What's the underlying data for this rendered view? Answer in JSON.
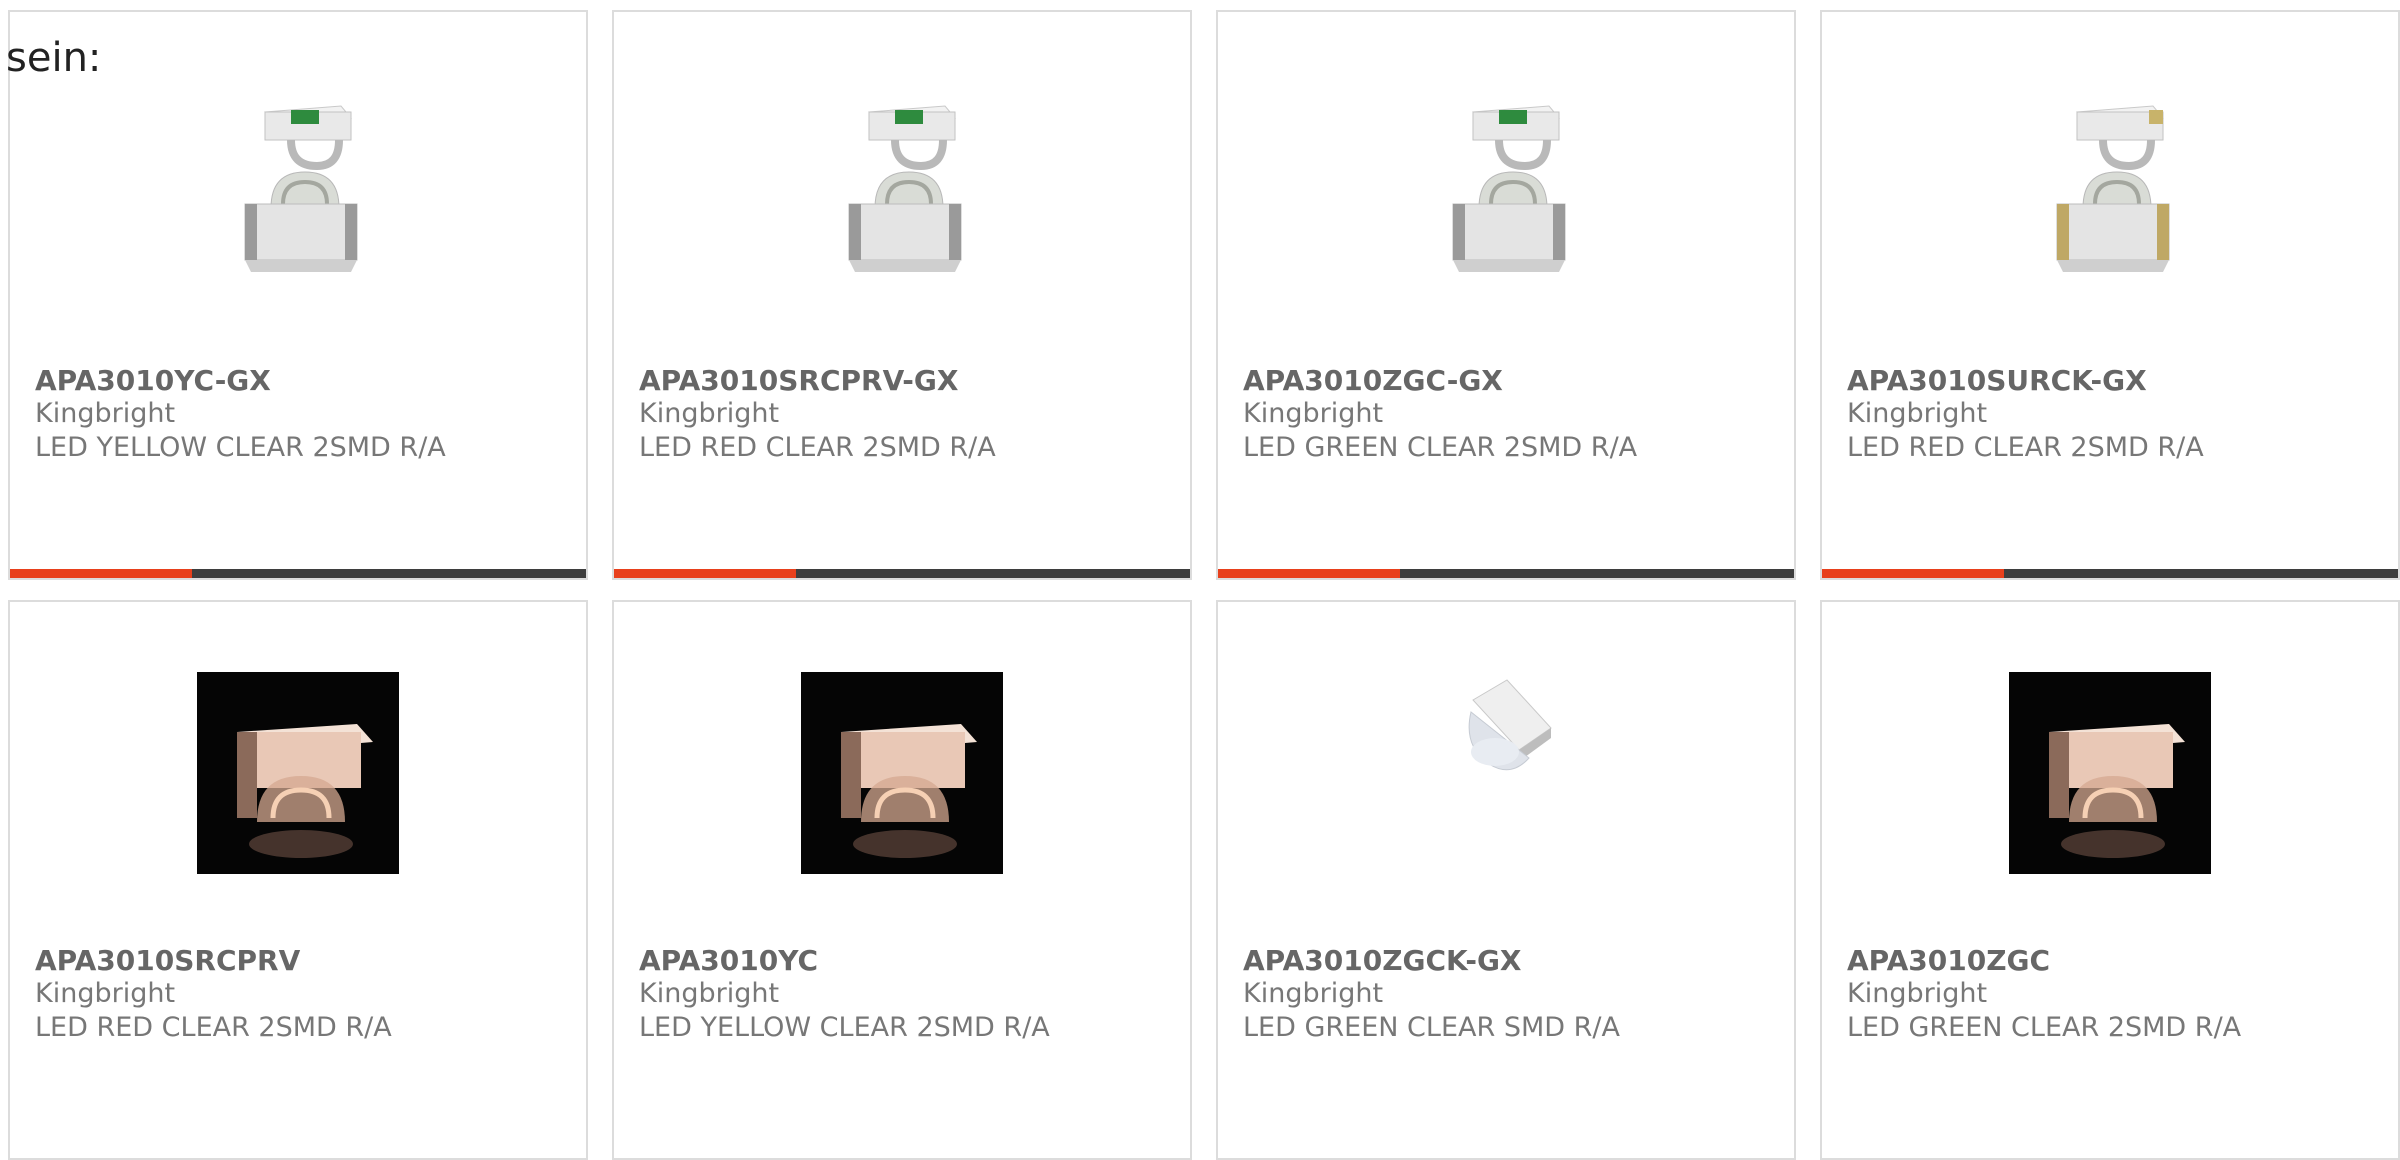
{
  "intro_text": "sein:",
  "accent_color": "#e8401c",
  "products": [
    {
      "part_number": "APA3010YC-GX",
      "manufacturer": "Kingbright",
      "description": "LED YELLOW CLEAR 2SMD R/A",
      "image": "smd-led-pair-green-top"
    },
    {
      "part_number": "APA3010SRCPRV-GX",
      "manufacturer": "Kingbright",
      "description": "LED RED CLEAR 2SMD R/A",
      "image": "smd-led-pair-green-top"
    },
    {
      "part_number": "APA3010ZGC-GX",
      "manufacturer": "Kingbright",
      "description": "LED GREEN CLEAR 2SMD R/A",
      "image": "smd-led-pair-green-top"
    },
    {
      "part_number": "APA3010SURCK-GX",
      "manufacturer": "Kingbright",
      "description": "LED RED CLEAR 2SMD R/A",
      "image": "smd-led-pair-gold"
    },
    {
      "part_number": "APA3010SRCPRV",
      "manufacturer": "Kingbright",
      "description": "LED RED CLEAR 2SMD R/A",
      "image": "smd-led-dark-photo"
    },
    {
      "part_number": "APA3010YC",
      "manufacturer": "Kingbright",
      "description": "LED YELLOW CLEAR 2SMD R/A",
      "image": "smd-led-dark-photo"
    },
    {
      "part_number": "APA3010ZGCK-GX",
      "manufacturer": "Kingbright",
      "description": "LED GREEN CLEAR SMD R/A",
      "image": "smd-led-single-light"
    },
    {
      "part_number": "APA3010ZGC",
      "manufacturer": "Kingbright",
      "description": "LED GREEN CLEAR 2SMD R/A",
      "image": "smd-led-dark-photo"
    }
  ]
}
